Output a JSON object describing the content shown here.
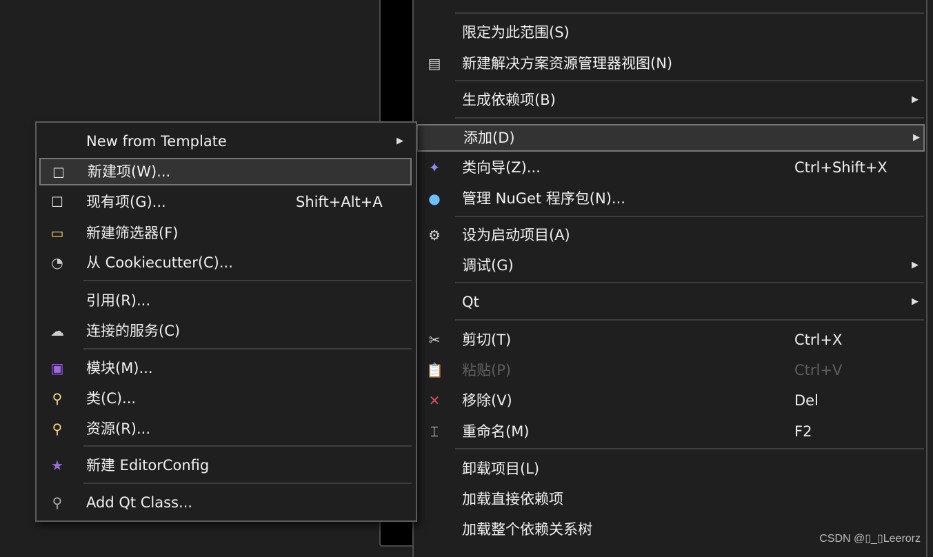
{
  "right_menu": {
    "items": [
      {
        "label": "限定为此范围(S)",
        "shortcut": "",
        "icon": "",
        "submenu": false
      },
      {
        "label": "新建解决方案资源管理器视图(N)",
        "shortcut": "",
        "icon": "new-view-icon",
        "submenu": false
      },
      {
        "label": "生成依赖项(B)",
        "shortcut": "",
        "icon": "",
        "submenu": true
      },
      {
        "label": "添加(D)",
        "shortcut": "",
        "icon": "",
        "submenu": true,
        "highlighted": true
      },
      {
        "label": "类向导(Z)...",
        "shortcut": "Ctrl+Shift+X",
        "icon": "class-wizard-icon",
        "submenu": false
      },
      {
        "label": "管理 NuGet 程序包(N)...",
        "shortcut": "",
        "icon": "nuget-icon",
        "submenu": false
      },
      {
        "label": "设为启动项目(A)",
        "shortcut": "",
        "icon": "gear-icon",
        "submenu": false
      },
      {
        "label": "调试(G)",
        "shortcut": "",
        "icon": "",
        "submenu": true
      },
      {
        "label": "Qt",
        "shortcut": "",
        "icon": "",
        "submenu": true
      },
      {
        "label": "剪切(T)",
        "shortcut": "Ctrl+X",
        "icon": "scissors-icon",
        "submenu": false
      },
      {
        "label": "粘贴(P)",
        "shortcut": "Ctrl+V",
        "icon": "paste-icon",
        "submenu": false,
        "disabled": true
      },
      {
        "label": "移除(V)",
        "shortcut": "Del",
        "icon": "remove-x-icon",
        "submenu": false
      },
      {
        "label": "重命名(M)",
        "shortcut": "F2",
        "icon": "rename-icon",
        "submenu": false
      },
      {
        "label": "卸载项目(L)",
        "shortcut": "",
        "icon": "",
        "submenu": false
      },
      {
        "label": "加载直接依赖项",
        "shortcut": "",
        "icon": "",
        "submenu": false
      },
      {
        "label": "加载整个依赖关系树",
        "shortcut": "",
        "icon": "",
        "submenu": false
      }
    ]
  },
  "add_submenu": {
    "items": [
      {
        "label": "New from Template",
        "shortcut": "",
        "icon": "",
        "submenu": true
      },
      {
        "label": "新建项(W)...",
        "shortcut": "",
        "icon": "new-item-icon",
        "submenu": false,
        "highlighted": true
      },
      {
        "label": "现有项(G)...",
        "shortcut": "Shift+Alt+A",
        "icon": "existing-item-icon",
        "submenu": false
      },
      {
        "label": "新建筛选器(F)",
        "shortcut": "",
        "icon": "new-filter-icon",
        "submenu": false
      },
      {
        "label": "从 Cookiecutter(C)...",
        "shortcut": "",
        "icon": "cookiecutter-icon",
        "submenu": false
      },
      {
        "label": "引用(R)...",
        "shortcut": "",
        "icon": "",
        "submenu": false
      },
      {
        "label": "连接的服务(C)",
        "shortcut": "",
        "icon": "connected-service-icon",
        "submenu": false
      },
      {
        "label": "模块(M)...",
        "shortcut": "",
        "icon": "module-icon",
        "submenu": false
      },
      {
        "label": "类(C)...",
        "shortcut": "",
        "icon": "add-class-icon",
        "submenu": false
      },
      {
        "label": "资源(R)...",
        "shortcut": "",
        "icon": "add-resource-icon",
        "submenu": false
      },
      {
        "label": "新建 EditorConfig",
        "shortcut": "",
        "icon": "editorconfig-icon",
        "submenu": false
      },
      {
        "label": "Add Qt Class...",
        "shortcut": "",
        "icon": "qt-class-icon",
        "submenu": false
      }
    ]
  },
  "watermark": "CSDN @▯_▯Leerorz",
  "colors": {
    "background": "#1f1f1f",
    "highlight": "#333333",
    "remove": "#e0455a",
    "nuget": "#6cc0ff",
    "class_icon": "#f5d68a",
    "module": "#9a6ad6",
    "add_plus": "#7ed07e"
  }
}
